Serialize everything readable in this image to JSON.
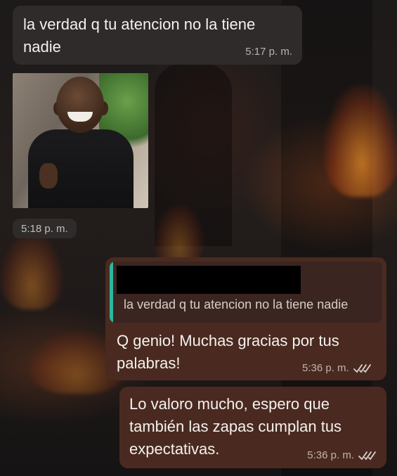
{
  "messages": {
    "m1": {
      "text": "la verdad q tu atencion no la tiene nadie",
      "time": "5:17 p. m."
    },
    "m2": {
      "time": "5:18 p. m."
    },
    "m3": {
      "quoted_text": "la verdad q tu atencion no la tiene nadie",
      "text": "Q genio! Muchas gracias por tus palabras!",
      "time": "5:36 p. m."
    },
    "m4": {
      "text": "Lo valoro mucho, espero que también las zapas cumplan tus expectativas.",
      "time": "5:36 p. m."
    }
  },
  "colors": {
    "incoming_bubble": "#2e2b2a",
    "outgoing_bubble": "#4a2a20",
    "quote_accent": "#2bb7a0",
    "read_ticks": "#d8d3cf"
  },
  "icons": {
    "read_receipt": "double-check-icon"
  }
}
